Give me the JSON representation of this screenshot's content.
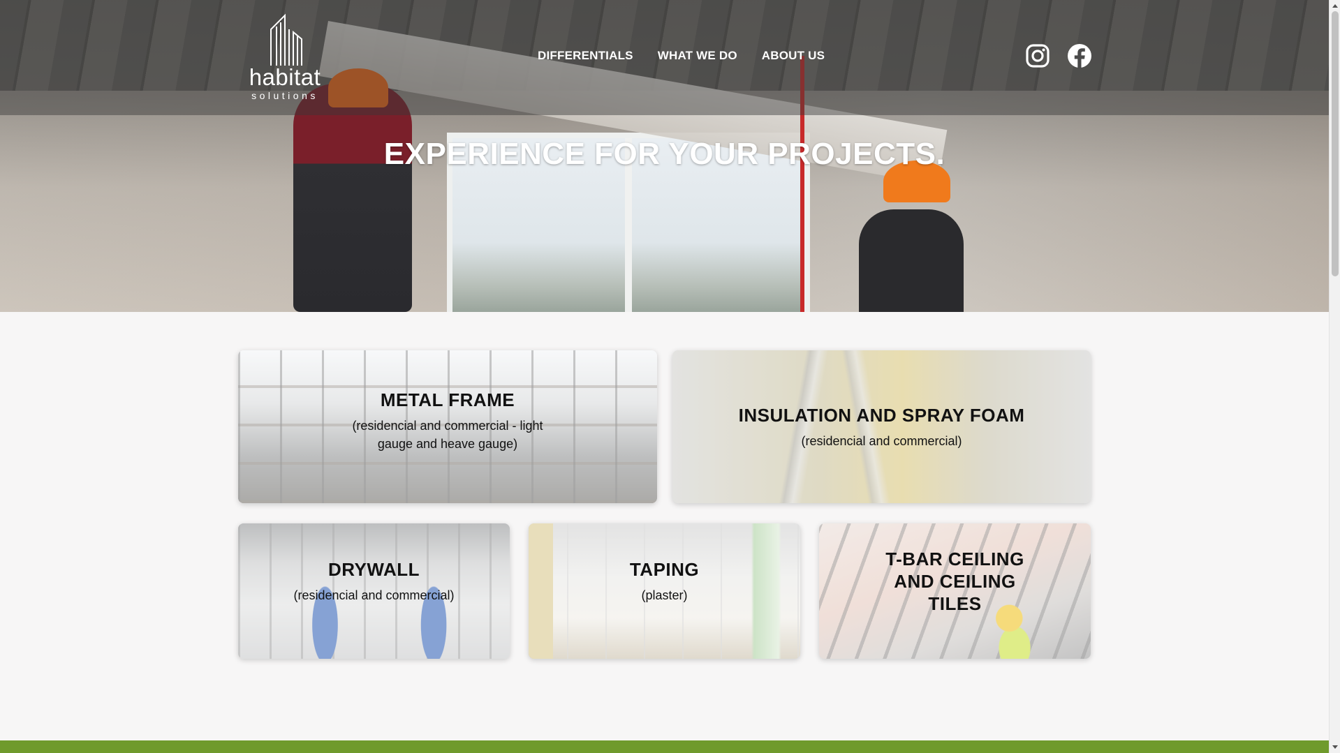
{
  "logo": {
    "brand": "habitat",
    "sub": "solutions"
  },
  "nav": {
    "items": [
      {
        "label": "DIFFERENTIALS"
      },
      {
        "label": "WHAT WE DO"
      },
      {
        "label": "ABOUT US"
      }
    ]
  },
  "social": {
    "icons": [
      "instagram-icon",
      "facebook-icon"
    ]
  },
  "hero": {
    "title": "EXPERIENCE FOR YOUR PROJECTS."
  },
  "services": [
    {
      "title": "METAL FRAME",
      "subtitle": "(residencial and commercial - light gauge and heave gauge)"
    },
    {
      "title": "INSULATION AND SPRAY FOAM",
      "subtitle": "(residencial and commercial)"
    },
    {
      "title": "DRYWALL",
      "subtitle": "(residencial and commercial)"
    },
    {
      "title": "TAPING",
      "subtitle": "(plaster)"
    },
    {
      "title": "T-BAR CEILING AND CEILING TILES",
      "subtitle": ""
    }
  ],
  "colors": {
    "footer_band": "#6f9a2c",
    "page_bg": "#f7f6f6",
    "nav_text": "#ffffff"
  }
}
